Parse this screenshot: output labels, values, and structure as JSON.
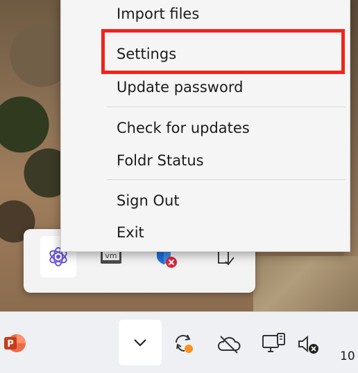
{
  "context_menu": {
    "items": [
      {
        "label": "Import files"
      },
      {
        "label": "Settings"
      },
      {
        "label": "Update password"
      },
      {
        "label": "Check for updates"
      },
      {
        "label": "Foldr Status"
      },
      {
        "label": "Sign Out"
      },
      {
        "label": "Exit"
      }
    ],
    "highlighted_item": "Settings",
    "highlight_color": "#f0241a"
  },
  "tray_flyout": {
    "icons": [
      "foldr-app-icon",
      "vmware-icon",
      "shield-error-icon",
      "usb-safely-remove-icon"
    ],
    "vm_text": "vm"
  },
  "taskbar": {
    "pinned": [
      {
        "icon": "powerpoint-icon",
        "letter": "P",
        "color": "#c43e1c"
      }
    ],
    "tray_icons": [
      "chevron-up-icon",
      "sync-icon",
      "onedrive-offline-icon",
      "network-icon",
      "volume-muted-icon"
    ],
    "clock_partial": "10",
    "sync_badge_color": "#f7941d"
  }
}
